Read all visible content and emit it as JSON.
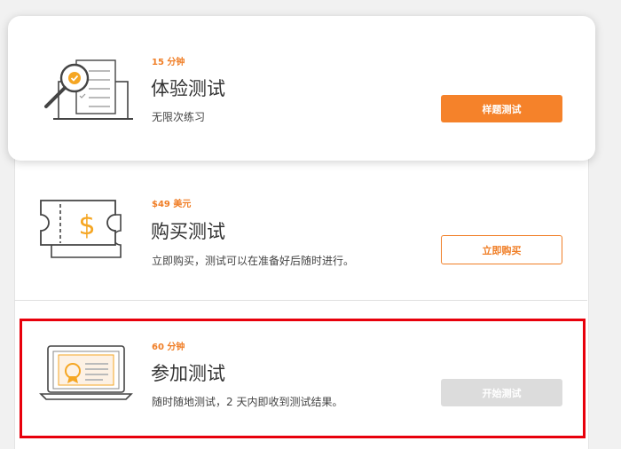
{
  "trial": {
    "duration": "15 分钟",
    "title": "体验测试",
    "description": "无限次练习",
    "button_label": "样题测试",
    "icon": "magnifier-checklist-icon"
  },
  "purchase": {
    "price": "$49 美元",
    "title": "购买测试",
    "description": "立即购买，测试可以在准备好后随时进行。",
    "button_label": "立即购买",
    "icon": "ticket-dollar-icon"
  },
  "take": {
    "duration": "60 分钟",
    "title": "参加测试",
    "description": "随时随地测试，2 天内即收到测试结果。",
    "button_label": "开始测试",
    "icon": "laptop-certificate-icon"
  },
  "colors": {
    "accent": "#f5822a",
    "highlight": "#e8000b",
    "disabled": "#dcdcdc"
  }
}
